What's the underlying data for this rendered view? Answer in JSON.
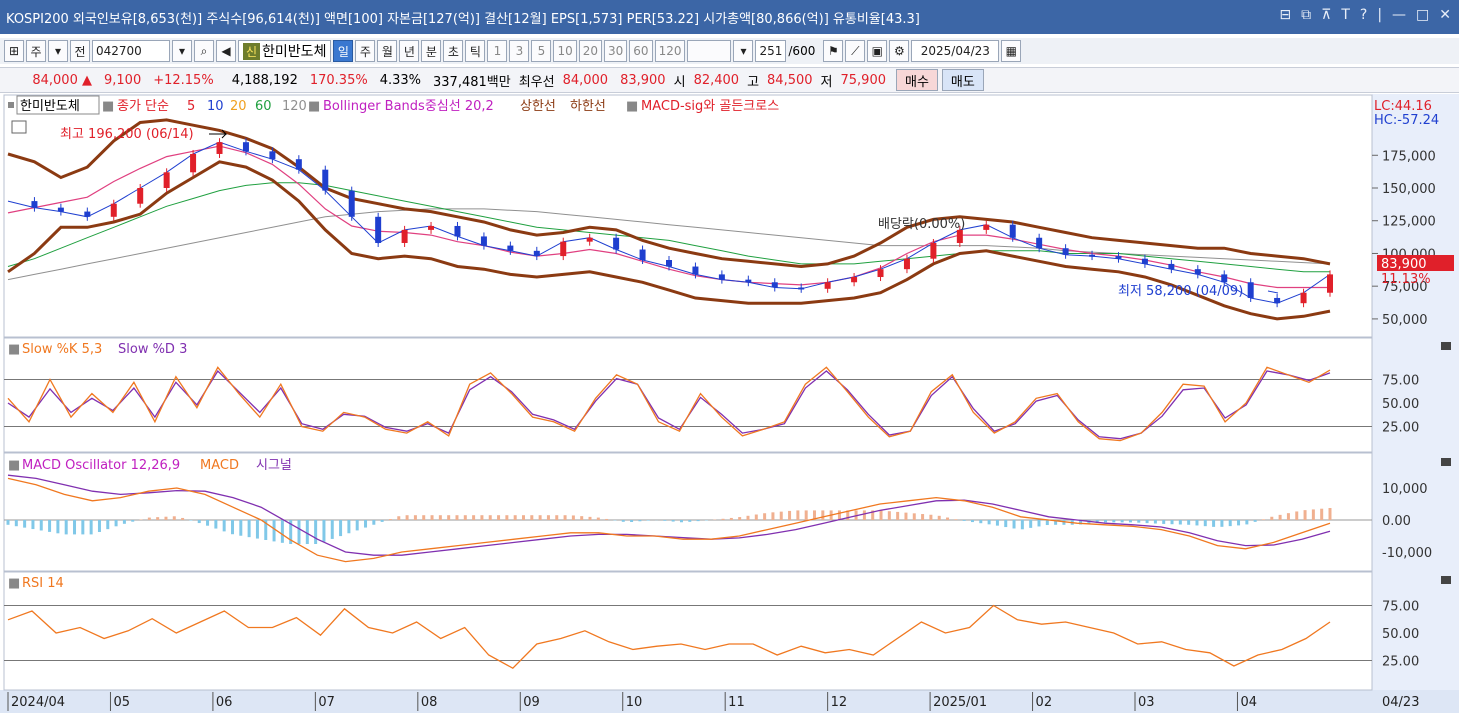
{
  "titlebar": {
    "text": "KOSPI200 외국인보유[8,653(천)] 주식수[96,614(천)] 액면[100] 자본금[127(억)] 결산[12월] EPS[1,573] PER[53.22] 시가총액[80,866(억)] 유통비율[43.3]",
    "controls": [
      "⊟",
      "⧉",
      "⊼",
      "T",
      "?",
      "|",
      "—",
      "□",
      "✕"
    ]
  },
  "toolbar": {
    "tab_icon": "⊞",
    "period_label": "주",
    "market_label": "전",
    "code": "042700",
    "search_icon": "🔍",
    "sound_icon": "◀",
    "new_badge": "신",
    "stock_name": "한미반도체",
    "periods": [
      "일",
      "주",
      "월",
      "년",
      "분",
      "초",
      "틱"
    ],
    "active_period": "일",
    "minutes": [
      "1",
      "3",
      "5",
      "10",
      "20",
      "30",
      "60",
      "120"
    ],
    "count": "251",
    "total": "/600",
    "date": "2025/04/23"
  },
  "quote": {
    "price": "84,000",
    "change": "9,100",
    "change_pct": "+12.15%",
    "volume": "4,188,192",
    "volume_ratio": "170.35%",
    "turnover": "4.33%",
    "amount": "337,481백만",
    "best_label": "최우선",
    "ask": "84,000",
    "bid": "83,900",
    "open_label": "시",
    "open": "82,400",
    "high_label": "고",
    "high": "84,500",
    "low_label": "저",
    "low": "75,900",
    "buy_label": "매수",
    "sell_label": "매도"
  },
  "legends": {
    "price": {
      "name": "한미반도체",
      "ma_label": "종가 단순",
      "ma_periods": [
        "5",
        "10",
        "20",
        "60",
        "120"
      ],
      "bb_label": "Bollinger Bands중심선 20,2",
      "upper_label": "상한선",
      "lower_label": "하한선",
      "macd_sig_label": "MACD-sig와 골든크로스"
    },
    "stoch": {
      "k": "Slow %K 5,3",
      "d": "Slow %D 3"
    },
    "macd": {
      "osc": "MACD Oscillator 12,26,9",
      "macd": "MACD",
      "signal": "시그널"
    },
    "rsi": {
      "name": "RSI 14"
    }
  },
  "annotations": {
    "high_note": "최고 196,200 (06/14)",
    "low_note": "최저 58,200 (04/09)",
    "dividend": "배당락(0.00%)",
    "lc": "LC:44.16",
    "hc": "HC:-57.24",
    "last_price": "83,900",
    "last_pct": "11.13%"
  },
  "axes": {
    "price_ticks": [
      "175,000",
      "150,000",
      "125,000",
      "100,000",
      "75,000",
      "50,000"
    ],
    "stoch_ticks": [
      "75.00",
      "50.00",
      "25.00"
    ],
    "macd_ticks": [
      "10,000",
      "0.00",
      "-10,000"
    ],
    "rsi_ticks": [
      "75.00",
      "50.00",
      "25.00"
    ],
    "x_labels": [
      "2024/04",
      "05",
      "06",
      "07",
      "08",
      "09",
      "10",
      "11",
      "12",
      "2025/01",
      "02",
      "03",
      "04"
    ],
    "current_date": "04/23"
  },
  "colors": {
    "up": "#e0202a",
    "down": "#1f3fcf",
    "bb_band": "#8b3a12",
    "ma5": "#e0202a",
    "ma10": "#2040d0",
    "ma20": "#e04080",
    "ma60": "#20a040",
    "ma120": "#909090",
    "stoch_k": "#f07820",
    "stoch_d": "#8030b0",
    "macd": "#f07820",
    "signal": "#8030b0",
    "osc_pos": "#f0b090",
    "osc_neg": "#80c8e8",
    "rsi": "#f07820"
  },
  "chart_data": [
    {
      "type": "candlestick",
      "title": "한미반도체",
      "ylim": [
        40000,
        205000
      ],
      "yticks": [
        50000,
        75000,
        100000,
        125000,
        150000,
        175000
      ],
      "x": [
        "2024/04",
        "05",
        "06",
        "07",
        "08",
        "09",
        "10",
        "11",
        "12",
        "2025/01",
        "02",
        "03",
        "04"
      ],
      "close": [
        140000,
        135000,
        132000,
        128000,
        138000,
        150000,
        162000,
        176000,
        185000,
        178000,
        172000,
        164000,
        148000,
        128000,
        108000,
        118000,
        121000,
        113000,
        106000,
        102000,
        98000,
        109000,
        112000,
        103000,
        95000,
        90000,
        84000,
        80000,
        78000,
        74000,
        73000,
        78000,
        82000,
        88000,
        96000,
        108000,
        118000,
        122000,
        112000,
        104000,
        99000,
        98000,
        96000,
        92000,
        88000,
        84000,
        78000,
        66000,
        62000,
        70000,
        84000
      ],
      "bb_upper": [
        176000,
        170000,
        158000,
        166000,
        186000,
        200000,
        202000,
        198000,
        194000,
        188000,
        180000,
        166000,
        150000,
        142000,
        138000,
        134000,
        132000,
        128000,
        124000,
        118000,
        114000,
        116000,
        120000,
        118000,
        110000,
        104000,
        100000,
        96000,
        94000,
        92000,
        90000,
        92000,
        98000,
        108000,
        120000,
        126000,
        128000,
        126000,
        124000,
        120000,
        116000,
        112000,
        110000,
        108000,
        106000,
        104000,
        104000,
        100000,
        98000,
        96000,
        92000
      ],
      "bb_lower": [
        86000,
        100000,
        120000,
        120000,
        124000,
        130000,
        146000,
        158000,
        170000,
        166000,
        156000,
        140000,
        118000,
        100000,
        96000,
        98000,
        96000,
        90000,
        88000,
        84000,
        82000,
        84000,
        86000,
        82000,
        78000,
        72000,
        66000,
        64000,
        62000,
        62000,
        62000,
        64000,
        66000,
        70000,
        80000,
        92000,
        100000,
        102000,
        98000,
        94000,
        90000,
        88000,
        86000,
        82000,
        76000,
        68000,
        60000,
        54000,
        50000,
        52000,
        56000
      ],
      "ma60": [
        90000,
        96000,
        104000,
        112000,
        120000,
        128000,
        136000,
        142000,
        148000,
        152000,
        154000,
        154000,
        152000,
        148000,
        144000,
        140000,
        136000,
        132000,
        128000,
        124000,
        120000,
        118000,
        116000,
        114000,
        112000,
        110000,
        106000,
        102000,
        98000,
        95000,
        92000,
        92000,
        92000,
        94000,
        96000,
        98000,
        100000,
        102000,
        102000,
        102000,
        100000,
        100000,
        100000,
        98000,
        96000,
        94000,
        92000,
        90000,
        88000,
        86000,
        86000
      ],
      "ma120": [
        80000,
        84000,
        88000,
        92000,
        96000,
        100000,
        104000,
        108000,
        112000,
        116000,
        120000,
        124000,
        128000,
        130000,
        132000,
        133000,
        134000,
        134000,
        134000,
        133000,
        132000,
        130000,
        128000,
        126000,
        124000,
        122000,
        120000,
        118000,
        116000,
        114000,
        112000,
        110000,
        108000,
        106000,
        106000,
        106000,
        106000,
        106000,
        105000,
        104000,
        102000,
        101000,
        100000,
        99000,
        98000,
        97000,
        96000,
        95000,
        94000,
        93000,
        92000
      ]
    },
    {
      "type": "line",
      "title": "Slow %K 5,3 Slow %D 3",
      "ylim": [
        0,
        100
      ],
      "series": [
        {
          "name": "Slow %K 5,3",
          "values": [
            55,
            30,
            75,
            35,
            60,
            40,
            72,
            30,
            78,
            45,
            88,
            60,
            35,
            70,
            25,
            20,
            40,
            35,
            22,
            18,
            30,
            15,
            70,
            82,
            60,
            35,
            30,
            20,
            55,
            80,
            70,
            30,
            20,
            60,
            35,
            15,
            22,
            30,
            70,
            88,
            62,
            35,
            14,
            20,
            62,
            80,
            40,
            18,
            30,
            55,
            60,
            30,
            12,
            10,
            18,
            40,
            70,
            68,
            30,
            50,
            88,
            80,
            72,
            85
          ]
        },
        {
          "name": "Slow %D 3",
          "values": [
            50,
            35,
            65,
            40,
            55,
            42,
            66,
            35,
            72,
            48,
            84,
            62,
            40,
            66,
            28,
            22,
            38,
            36,
            24,
            20,
            28,
            18,
            64,
            78,
            62,
            38,
            32,
            22,
            52,
            76,
            70,
            34,
            22,
            56,
            38,
            18,
            22,
            28,
            66,
            84,
            64,
            38,
            16,
            20,
            58,
            78,
            44,
            20,
            28,
            52,
            58,
            32,
            14,
            12,
            18,
            36,
            64,
            66,
            34,
            48,
            84,
            80,
            74,
            82
          ]
        }
      ]
    },
    {
      "type": "line",
      "title": "MACD Oscillator 12,26,9",
      "ylim": [
        -15000,
        15000
      ],
      "series": [
        {
          "name": "MACD",
          "values": [
            13000,
            11000,
            8000,
            6000,
            7000,
            9000,
            10000,
            8000,
            4000,
            0,
            -6000,
            -11000,
            -13000,
            -12000,
            -10000,
            -9000,
            -8000,
            -7000,
            -6000,
            -5000,
            -4000,
            -4000,
            -5000,
            -5000,
            -6000,
            -6000,
            -5000,
            -3000,
            -1000,
            1000,
            3000,
            5000,
            6000,
            7000,
            6000,
            4000,
            1000,
            0,
            -1000,
            -1500,
            -2000,
            -3000,
            -5000,
            -8000,
            -9000,
            -7000,
            -4000,
            -1000
          ]
        },
        {
          "name": "시그널",
          "values": [
            14000,
            13000,
            11000,
            9000,
            8000,
            8500,
            9200,
            9000,
            7000,
            4000,
            -1000,
            -6000,
            -10000,
            -11000,
            -11000,
            -10000,
            -9000,
            -8000,
            -7000,
            -6000,
            -5000,
            -4500,
            -4500,
            -5000,
            -5500,
            -6000,
            -5600,
            -4500,
            -3000,
            -1000,
            1000,
            3000,
            4500,
            6000,
            6200,
            5000,
            3000,
            1000,
            0,
            -1000,
            -1500,
            -2200,
            -4000,
            -6500,
            -8000,
            -7800,
            -6000,
            -3500
          ]
        }
      ]
    },
    {
      "type": "line",
      "title": "RSI 14",
      "ylim": [
        0,
        100
      ],
      "series": [
        {
          "name": "RSI 14",
          "values": [
            62,
            70,
            50,
            55,
            45,
            52,
            63,
            50,
            60,
            70,
            55,
            55,
            64,
            48,
            72,
            55,
            50,
            60,
            45,
            55,
            30,
            18,
            40,
            45,
            52,
            42,
            35,
            38,
            40,
            35,
            40,
            40,
            30,
            38,
            32,
            35,
            30,
            45,
            60,
            50,
            55,
            75,
            62,
            58,
            60,
            55,
            50,
            40,
            42,
            35,
            32,
            20,
            30,
            35,
            45,
            60
          ]
        }
      ]
    }
  ]
}
